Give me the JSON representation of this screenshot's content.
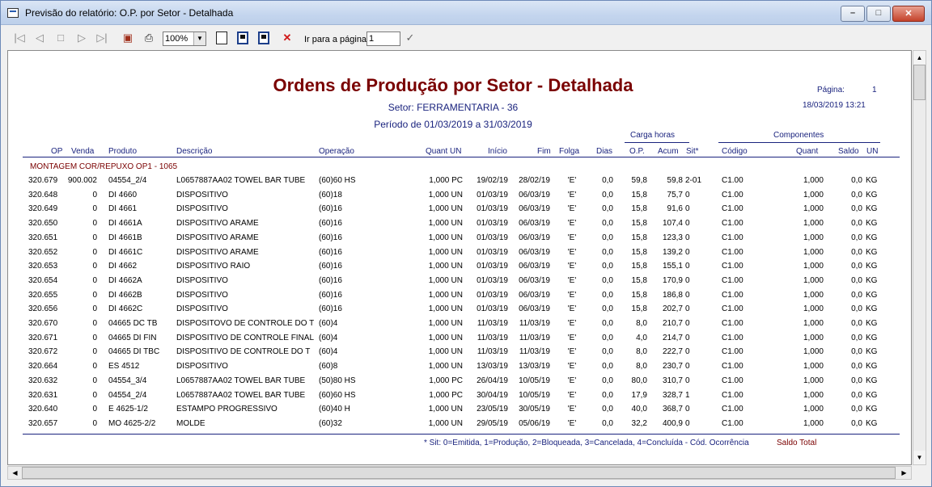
{
  "window": {
    "title": "Previsão do relatório: O.P. por Setor - Detalhada",
    "minimize_glyph": "–",
    "maximize_glyph": "□",
    "close_glyph": "✕"
  },
  "toolbar": {
    "zoom_value": "100%",
    "goto_label": "Ir para a página",
    "goto_value": "1",
    "first_glyph": "|◁",
    "prev_glyph": "◁",
    "stop_glyph": "□",
    "next_glyph": "▷",
    "last_glyph": "▷|",
    "export_glyph": "▣",
    "print_glyph": "⎙",
    "close_glyph": "✕",
    "confirm_glyph": "✓"
  },
  "report": {
    "title": "Ordens de Produção por Setor - Detalhada",
    "sector": "Setor: FERRAMENTARIA - 36",
    "period": "Período de 01/03/2019 a 31/03/2019",
    "page_label": "Página:",
    "page_number": "1",
    "datetime": "18/03/2019   13:21",
    "group_carga": "Carga horas",
    "group_componentes": "Componentes",
    "headers": {
      "op": "OP",
      "venda": "Venda",
      "produto": "Produto",
      "descricao": "Descrição",
      "operacao": "Operação",
      "quant_un": "Quant UN",
      "inicio": "Início",
      "fim": "Fim",
      "folga": "Folga",
      "dias": "Dias",
      "op_h": "O.P.",
      "acum": "Acum",
      "sit": "Sit*",
      "codigo": "Código",
      "quant": "Quant",
      "saldo": "Saldo",
      "un": "UN"
    },
    "section": "MONTAGEM COR/REPUXO OP1 - 1065",
    "rows": [
      {
        "op": "320.679",
        "venda": "900.002",
        "produto": "04554_2/4",
        "descricao": "L0657887AA02  TOWEL BAR TUBE",
        "operacao": "(60)60 HS",
        "quant": "1,000 PC",
        "inicio": "19/02/19",
        "fim": "28/02/19",
        "folga": "'E'",
        "dias": "0,0",
        "oph": "59,8",
        "acum": "59,8",
        "sit": "2-01",
        "codigo": "C1.00",
        "cquant": "1,000",
        "saldo": "0,0",
        "un": "KG"
      },
      {
        "op": "320.648",
        "venda": "0",
        "produto": "DI 4660",
        "descricao": "DISPOSITIVO",
        "operacao": "(60)18",
        "quant": "1,000 UN",
        "inicio": "01/03/19",
        "fim": "06/03/19",
        "folga": "'E'",
        "dias": "0,0",
        "oph": "15,8",
        "acum": "75,7",
        "sit": "0",
        "codigo": "C1.00",
        "cquant": "1,000",
        "saldo": "0,0",
        "un": "KG"
      },
      {
        "op": "320.649",
        "venda": "0",
        "produto": "DI 4661",
        "descricao": "DISPOSITIVO",
        "operacao": "(60)16",
        "quant": "1,000 UN",
        "inicio": "01/03/19",
        "fim": "06/03/19",
        "folga": "'E'",
        "dias": "0,0",
        "oph": "15,8",
        "acum": "91,6",
        "sit": "0",
        "codigo": "C1.00",
        "cquant": "1,000",
        "saldo": "0,0",
        "un": "KG"
      },
      {
        "op": "320.650",
        "venda": "0",
        "produto": "DI 4661A",
        "descricao": "DISPOSITIVO ARAME",
        "operacao": "(60)16",
        "quant": "1,000 UN",
        "inicio": "01/03/19",
        "fim": "06/03/19",
        "folga": "'E'",
        "dias": "0,0",
        "oph": "15,8",
        "acum": "107,4",
        "sit": "0",
        "codigo": "C1.00",
        "cquant": "1,000",
        "saldo": "0,0",
        "un": "KG"
      },
      {
        "op": "320.651",
        "venda": "0",
        "produto": "DI 4661B",
        "descricao": "DISPOSITIVO ARAME",
        "operacao": "(60)16",
        "quant": "1,000 UN",
        "inicio": "01/03/19",
        "fim": "06/03/19",
        "folga": "'E'",
        "dias": "0,0",
        "oph": "15,8",
        "acum": "123,3",
        "sit": "0",
        "codigo": "C1.00",
        "cquant": "1,000",
        "saldo": "0,0",
        "un": "KG"
      },
      {
        "op": "320.652",
        "venda": "0",
        "produto": "DI 4661C",
        "descricao": "DISPOSITIVO ARAME",
        "operacao": "(60)16",
        "quant": "1,000 UN",
        "inicio": "01/03/19",
        "fim": "06/03/19",
        "folga": "'E'",
        "dias": "0,0",
        "oph": "15,8",
        "acum": "139,2",
        "sit": "0",
        "codigo": "C1.00",
        "cquant": "1,000",
        "saldo": "0,0",
        "un": "KG"
      },
      {
        "op": "320.653",
        "venda": "0",
        "produto": "DI 4662",
        "descricao": "DISPOSITIVO RAIO",
        "operacao": "(60)16",
        "quant": "1,000 UN",
        "inicio": "01/03/19",
        "fim": "06/03/19",
        "folga": "'E'",
        "dias": "0,0",
        "oph": "15,8",
        "acum": "155,1",
        "sit": "0",
        "codigo": "C1.00",
        "cquant": "1,000",
        "saldo": "0,0",
        "un": "KG"
      },
      {
        "op": "320.654",
        "venda": "0",
        "produto": "DI 4662A",
        "descricao": "DISPOSITIVO",
        "operacao": "(60)16",
        "quant": "1,000 UN",
        "inicio": "01/03/19",
        "fim": "06/03/19",
        "folga": "'E'",
        "dias": "0,0",
        "oph": "15,8",
        "acum": "170,9",
        "sit": "0",
        "codigo": "C1.00",
        "cquant": "1,000",
        "saldo": "0,0",
        "un": "KG"
      },
      {
        "op": "320.655",
        "venda": "0",
        "produto": "DI 4662B",
        "descricao": "DISPOSITIVO",
        "operacao": "(60)16",
        "quant": "1,000 UN",
        "inicio": "01/03/19",
        "fim": "06/03/19",
        "folga": "'E'",
        "dias": "0,0",
        "oph": "15,8",
        "acum": "186,8",
        "sit": "0",
        "codigo": "C1.00",
        "cquant": "1,000",
        "saldo": "0,0",
        "un": "KG"
      },
      {
        "op": "320.656",
        "venda": "0",
        "produto": "DI 4662C",
        "descricao": "DISPOSITIVO",
        "operacao": "(60)16",
        "quant": "1,000 UN",
        "inicio": "01/03/19",
        "fim": "06/03/19",
        "folga": "'E'",
        "dias": "0,0",
        "oph": "15,8",
        "acum": "202,7",
        "sit": "0",
        "codigo": "C1.00",
        "cquant": "1,000",
        "saldo": "0,0",
        "un": "KG"
      },
      {
        "op": "320.670",
        "venda": "0",
        "produto": "04665 DC TB",
        "descricao": "DISPOSITOVO DE CONTROLE DO T",
        "operacao": "(60)4",
        "quant": "1,000 UN",
        "inicio": "11/03/19",
        "fim": "11/03/19",
        "folga": "'E'",
        "dias": "0,0",
        "oph": "8,0",
        "acum": "210,7",
        "sit": "0",
        "codigo": "C1.00",
        "cquant": "1,000",
        "saldo": "0,0",
        "un": "KG"
      },
      {
        "op": "320.671",
        "venda": "0",
        "produto": "04665 DI FIN",
        "descricao": "DISPOSITIVO DE CONTROLE FINAL",
        "operacao": "(60)4",
        "quant": "1,000 UN",
        "inicio": "11/03/19",
        "fim": "11/03/19",
        "folga": "'E'",
        "dias": "0,0",
        "oph": "4,0",
        "acum": "214,7",
        "sit": "0",
        "codigo": "C1.00",
        "cquant": "1,000",
        "saldo": "0,0",
        "un": "KG"
      },
      {
        "op": "320.672",
        "venda": "0",
        "produto": "04665 DI TBC",
        "descricao": "DISPOSITIVO DE CONTROLE DO T",
        "operacao": "(60)4",
        "quant": "1,000 UN",
        "inicio": "11/03/19",
        "fim": "11/03/19",
        "folga": "'E'",
        "dias": "0,0",
        "oph": "8,0",
        "acum": "222,7",
        "sit": "0",
        "codigo": "C1.00",
        "cquant": "1,000",
        "saldo": "0,0",
        "un": "KG"
      },
      {
        "op": "320.664",
        "venda": "0",
        "produto": "ES 4512",
        "descricao": "DISPOSITIVO",
        "operacao": "(60)8",
        "quant": "1,000 UN",
        "inicio": "13/03/19",
        "fim": "13/03/19",
        "folga": "'E'",
        "dias": "0,0",
        "oph": "8,0",
        "acum": "230,7",
        "sit": "0",
        "codigo": "C1.00",
        "cquant": "1,000",
        "saldo": "0,0",
        "un": "KG"
      },
      {
        "op": "320.632",
        "venda": "0",
        "produto": "04554_3/4",
        "descricao": "L0657887AA02  TOWEL BAR TUBE",
        "operacao": "(50)80 HS",
        "quant": "1,000 PC",
        "inicio": "26/04/19",
        "fim": "10/05/19",
        "folga": "'E'",
        "dias": "0,0",
        "oph": "80,0",
        "acum": "310,7",
        "sit": "0",
        "codigo": "C1.00",
        "cquant": "1,000",
        "saldo": "0,0",
        "un": "KG"
      },
      {
        "op": "320.631",
        "venda": "0",
        "produto": "04554_2/4",
        "descricao": "L0657887AA02  TOWEL BAR TUBE",
        "operacao": "(60)60 HS",
        "quant": "1,000 PC",
        "inicio": "30/04/19",
        "fim": "10/05/19",
        "folga": "'E'",
        "dias": "0,0",
        "oph": "17,9",
        "acum": "328,7",
        "sit": "1",
        "codigo": "C1.00",
        "cquant": "1,000",
        "saldo": "0,0",
        "un": "KG"
      },
      {
        "op": "320.640",
        "venda": "0",
        "produto": "E 4625-1/2",
        "descricao": "ESTAMPO PROGRESSIVO",
        "operacao": "(60)40 H",
        "quant": "1,000 UN",
        "inicio": "23/05/19",
        "fim": "30/05/19",
        "folga": "'E'",
        "dias": "0,0",
        "oph": "40,0",
        "acum": "368,7",
        "sit": "0",
        "codigo": "C1.00",
        "cquant": "1,000",
        "saldo": "0,0",
        "un": "KG"
      },
      {
        "op": "320.657",
        "venda": "0",
        "produto": "MO 4625-2/2",
        "descricao": "MOLDE",
        "operacao": "(60)32",
        "quant": "1,000 UN",
        "inicio": "29/05/19",
        "fim": "05/06/19",
        "folga": "'E'",
        "dias": "0,0",
        "oph": "32,2",
        "acum": "400,9",
        "sit": "0",
        "codigo": "C1.00",
        "cquant": "1,000",
        "saldo": "0,0",
        "un": "KG"
      }
    ],
    "legend": "* Sit: 0=Emitida, 1=Produção, 2=Bloqueada, 3=Cancelada, 4=Concluída - Cód. Ocorrência",
    "saldo_total": "Saldo Total"
  }
}
